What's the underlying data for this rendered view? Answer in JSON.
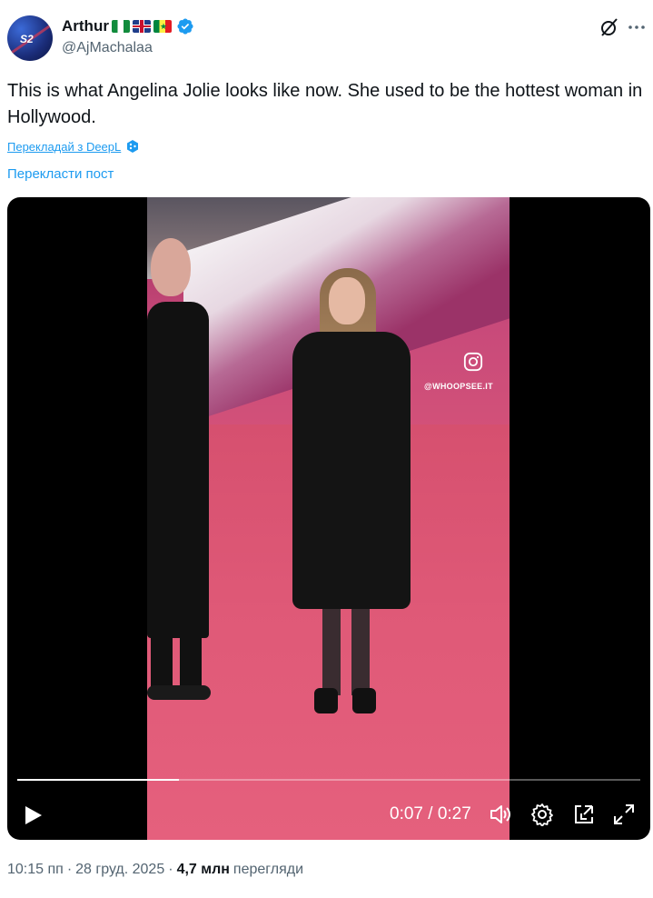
{
  "author": {
    "display_name": "Arthur",
    "handle": "@AjMachalaa",
    "avatar_text": "S2",
    "flags": [
      "nigeria-flag",
      "uk-flag",
      "senegal-flag"
    ]
  },
  "tweet": {
    "text": "This is what Angelina Jolie looks like now. She used to be the hottest woman in Hollywood.",
    "translate_deepl": "Перекладай з DeepL",
    "translate_post": "Перекласти пост"
  },
  "video": {
    "watermark": "@WHOOPSEE.IT",
    "current_time": "0:07",
    "duration": "0:27",
    "time_display": "0:07 / 0:27",
    "progress_fraction": 0.26
  },
  "meta": {
    "time": "10:15 пп",
    "separator": "·",
    "date": "28 груд. 2025",
    "views_count": "4,7 млн",
    "views_label": "перегляди"
  },
  "colors": {
    "link": "#1d9bf0",
    "verified": "#1d9bf0",
    "secondary_text": "#536471",
    "primary_text": "#0f1419"
  },
  "icons": {
    "verified": "verified-badge-icon",
    "grok": "grok-icon",
    "more": "more-icon",
    "deepl": "deepl-icon",
    "play": "play-icon",
    "volume": "volume-icon",
    "settings": "settings-gear-icon",
    "minimize": "picture-in-picture-icon",
    "fullscreen": "fullscreen-icon",
    "instagram": "instagram-icon"
  }
}
